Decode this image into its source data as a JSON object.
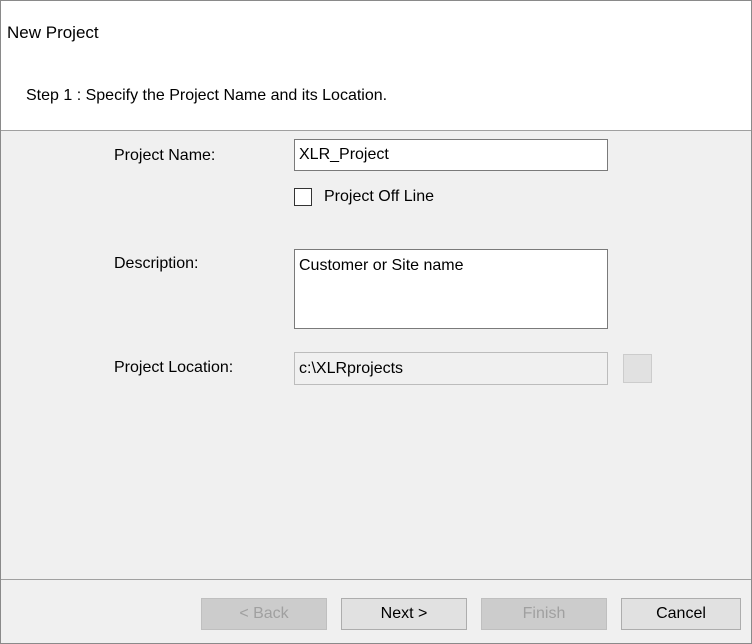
{
  "dialog": {
    "title": "New Project",
    "step": "Step 1 : Specify the Project Name and its Location."
  },
  "form": {
    "project_name_label": "Project Name:",
    "project_name_value": "XLR_Project",
    "offline_label": "Project Off Line",
    "offline_checked": false,
    "description_label": "Description:",
    "description_value": "Customer or Site name",
    "location_label": "Project Location:",
    "location_value": "c:\\XLRprojects"
  },
  "buttons": {
    "back": "< Back",
    "next": "Next >",
    "finish": "Finish",
    "cancel": "Cancel"
  },
  "colors": {
    "panel_bg": "#f0f0f0",
    "button_bg": "#e1e1e1",
    "disabled_text": "#a0a0a0"
  }
}
